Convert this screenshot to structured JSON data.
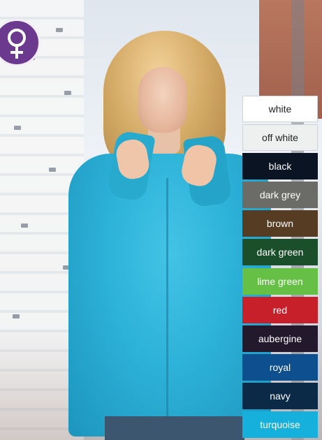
{
  "product": {
    "gender_badge": {
      "icon": "female-symbol-icon"
    },
    "colors": [
      {
        "label": "white",
        "hex": "#ffffff",
        "text": "#222222"
      },
      {
        "label": "off white",
        "hex": "#eef0f0",
        "text": "#222222"
      },
      {
        "label": "black",
        "hex": "#0b1422",
        "text": "#ffffff"
      },
      {
        "label": "dark grey",
        "hex": "#6b6b67",
        "text": "#ffffff"
      },
      {
        "label": "brown",
        "hex": "#573c24",
        "text": "#ffffff"
      },
      {
        "label": "dark green",
        "hex": "#1b4f2b",
        "text": "#ffffff"
      },
      {
        "label": "lime green",
        "hex": "#66c046",
        "text": "#ffffff"
      },
      {
        "label": "red",
        "hex": "#c8202b",
        "text": "#ffffff"
      },
      {
        "label": "aubergine",
        "hex": "#23192c",
        "text": "#ffffff"
      },
      {
        "label": "royal",
        "hex": "#0e4f8f",
        "text": "#ffffff"
      },
      {
        "label": "navy",
        "hex": "#0b2a48",
        "text": "#ffffff"
      },
      {
        "label": "turquoise",
        "hex": "#16b0dc",
        "text": "#ffffff"
      }
    ]
  }
}
